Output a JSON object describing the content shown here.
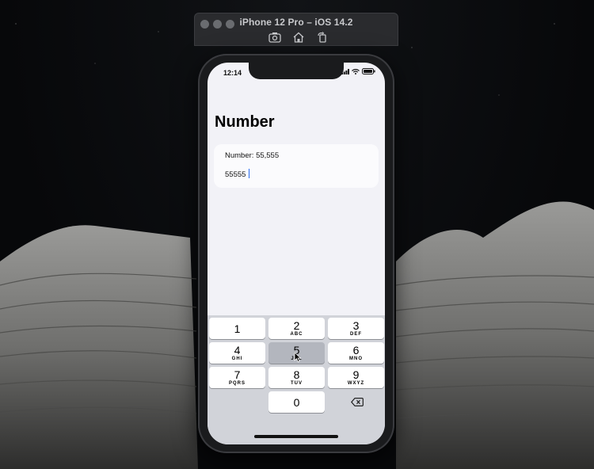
{
  "window": {
    "title": "iPhone 12 Pro – iOS 14.2",
    "tools": [
      "camera-icon",
      "home-icon",
      "rotate-icon"
    ]
  },
  "status_bar": {
    "time": "12:14",
    "icons": [
      "signal-icon",
      "wifi-icon",
      "battery-icon"
    ]
  },
  "page": {
    "title": "Number",
    "label": "Number: 55,555",
    "input_value": "55555"
  },
  "keyboard": {
    "keys": [
      {
        "num": "1",
        "letters": ""
      },
      {
        "num": "2",
        "letters": "ABC"
      },
      {
        "num": "3",
        "letters": "DEF"
      },
      {
        "num": "4",
        "letters": "GHI"
      },
      {
        "num": "5",
        "letters": "JKL"
      },
      {
        "num": "6",
        "letters": "MNO"
      },
      {
        "num": "7",
        "letters": "PQRS"
      },
      {
        "num": "8",
        "letters": "TUV"
      },
      {
        "num": "9",
        "letters": "WXYZ"
      },
      {
        "num": "0",
        "letters": ""
      }
    ],
    "pressed_key": "5",
    "delete_icon": "backspace-icon"
  },
  "colors": {
    "accent": "#2a6cf0",
    "screen_bg": "#f2f2f7",
    "keyboard_bg": "#d1d3d9"
  }
}
